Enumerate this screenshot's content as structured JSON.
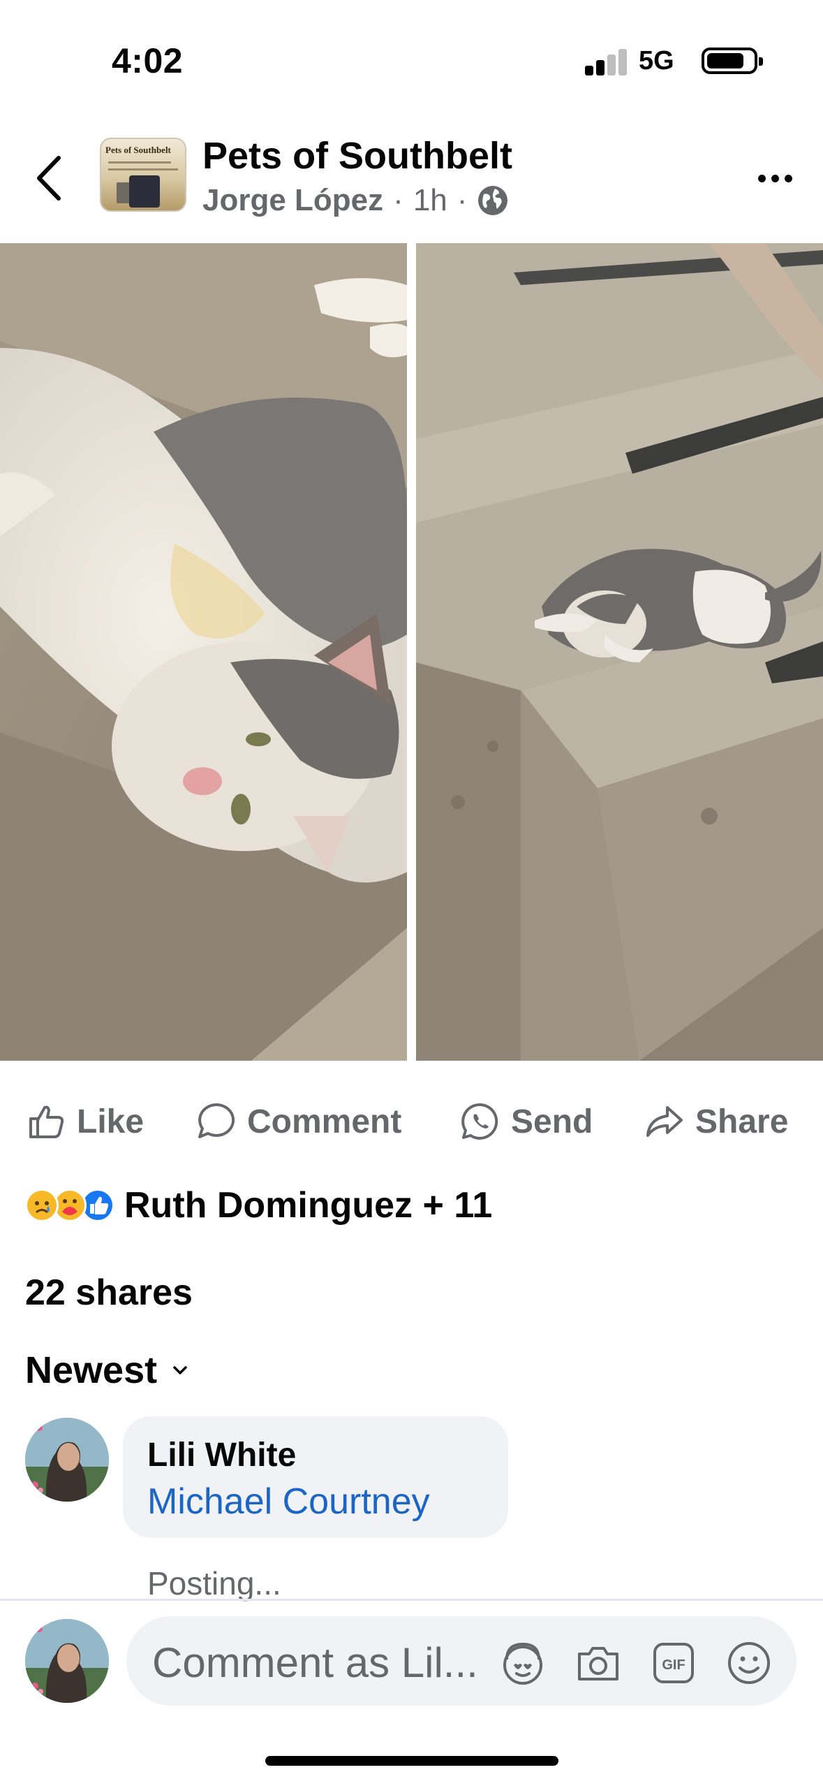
{
  "status": {
    "time": "4:02",
    "network": "5G"
  },
  "post": {
    "group_name": "Pets of Southbelt",
    "group_avatar_text": "Pets of Southbelt",
    "author": "Jorge López",
    "sep": "·",
    "age": "1h",
    "sep2": "·"
  },
  "actions": {
    "like": "Like",
    "comment": "Comment",
    "send": "Send",
    "share": "Share"
  },
  "reactions": {
    "text": "Ruth Dominguez + 11"
  },
  "shares": "22 shares",
  "sort": {
    "label": "Newest"
  },
  "comment": {
    "name": "Lili White",
    "mention": "Michael Courtney",
    "status": "Posting..."
  },
  "composer": {
    "placeholder": "Comment as Lil..."
  }
}
